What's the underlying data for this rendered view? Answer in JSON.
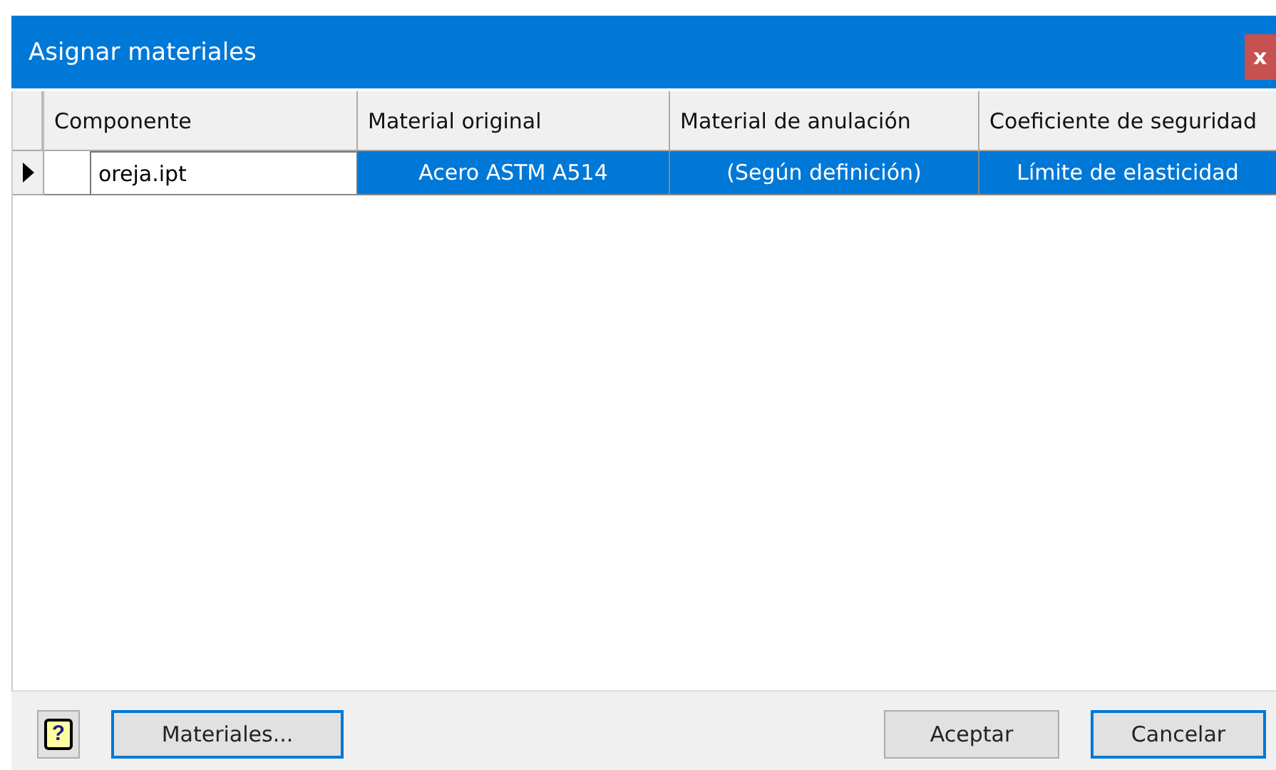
{
  "window": {
    "title": "Asignar materiales",
    "close": "x"
  },
  "table": {
    "columns": [
      "Componente",
      "Material original",
      "Material de anulación",
      "Coeficiente de seguridad"
    ],
    "rows": [
      {
        "selected": true,
        "cells": [
          "oreja.ipt",
          "Acero ASTM A514",
          "(Según definición)",
          "Límite de elasticidad"
        ]
      }
    ]
  },
  "buttons": [
    {
      "kind": "help",
      "label": "?",
      "focused": false
    },
    {
      "kind": "text",
      "label": "Materiales...",
      "focused": true
    },
    {
      "kind": "spacer"
    },
    {
      "kind": "text",
      "label": "Aceptar",
      "focused": false
    },
    {
      "kind": "text",
      "label": "Cancelar",
      "focused": true
    }
  ]
}
